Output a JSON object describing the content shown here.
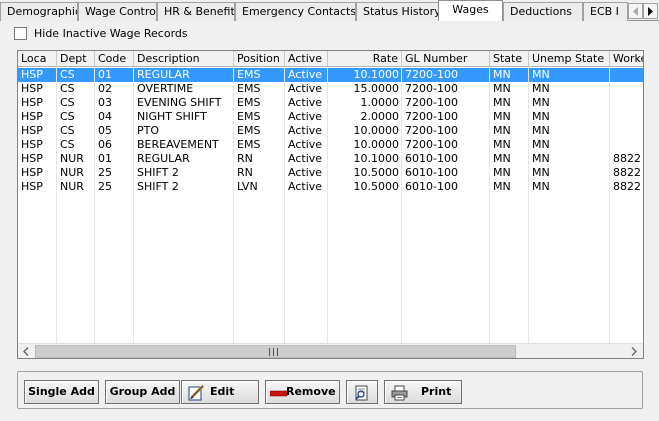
{
  "tabs": [
    {
      "label": "Demographics"
    },
    {
      "label": "Wage Control"
    },
    {
      "label": "HR & Benefits"
    },
    {
      "label": "Emergency Contacts"
    },
    {
      "label": "Status History"
    },
    {
      "label": "Wages",
      "active": true
    },
    {
      "label": "Deductions"
    },
    {
      "label": "ECB I"
    }
  ],
  "hide_inactive": {
    "label": "Hide Inactive Wage Records",
    "checked": false
  },
  "table": {
    "columns": [
      "Loca",
      "Dept",
      "Code",
      "Description",
      "Position",
      "Active",
      "Rate",
      "GL Number",
      "State",
      "Unemp State",
      "Worke"
    ],
    "rows": [
      [
        "HSP",
        "CS",
        "01",
        "REGULAR",
        "EMS",
        "Active",
        "10.1000",
        "7200-100",
        "MN",
        "MN",
        ""
      ],
      [
        "HSP",
        "CS",
        "02",
        "OVERTIME",
        "EMS",
        "Active",
        "15.0000",
        "7200-100",
        "MN",
        "MN",
        ""
      ],
      [
        "HSP",
        "CS",
        "03",
        "EVENING SHIFT",
        "EMS",
        "Active",
        "1.0000",
        "7200-100",
        "MN",
        "MN",
        ""
      ],
      [
        "HSP",
        "CS",
        "04",
        "NIGHT SHIFT",
        "EMS",
        "Active",
        "2.0000",
        "7200-100",
        "MN",
        "MN",
        ""
      ],
      [
        "HSP",
        "CS",
        "05",
        "PTO",
        "EMS",
        "Active",
        "10.0000",
        "7200-100",
        "MN",
        "MN",
        ""
      ],
      [
        "HSP",
        "CS",
        "06",
        "BEREAVEMENT",
        "EMS",
        "Active",
        "10.0000",
        "7200-100",
        "MN",
        "MN",
        ""
      ],
      [
        "HSP",
        "NUR",
        "01",
        "REGULAR",
        "RN",
        "Active",
        "10.1000",
        "6010-100",
        "MN",
        "MN",
        "8822"
      ],
      [
        "HSP",
        "NUR",
        "25",
        "SHIFT 2",
        "RN",
        "Active",
        "10.5000",
        "6010-100",
        "MN",
        "MN",
        "8822"
      ],
      [
        "HSP",
        "NUR",
        "25",
        "SHIFT 2",
        "LVN",
        "Active",
        "10.5000",
        "6010-100",
        "MN",
        "MN",
        "8822"
      ]
    ],
    "selected_row": 0
  },
  "buttons": {
    "single_add": "Single Add",
    "group_add": "Group Add",
    "edit": "Edit",
    "remove": "Remove",
    "print": "Print"
  },
  "icons": {
    "edit": "pencil-edit-icon",
    "remove": "red-bar-icon",
    "preview": "print-preview-icon",
    "print": "printer-icon",
    "tab_left": "left-arrow-icon",
    "tab_right": "right-arrow-icon"
  },
  "colors": {
    "selection": "#3399ff",
    "remove_bar": "#cc1111"
  }
}
